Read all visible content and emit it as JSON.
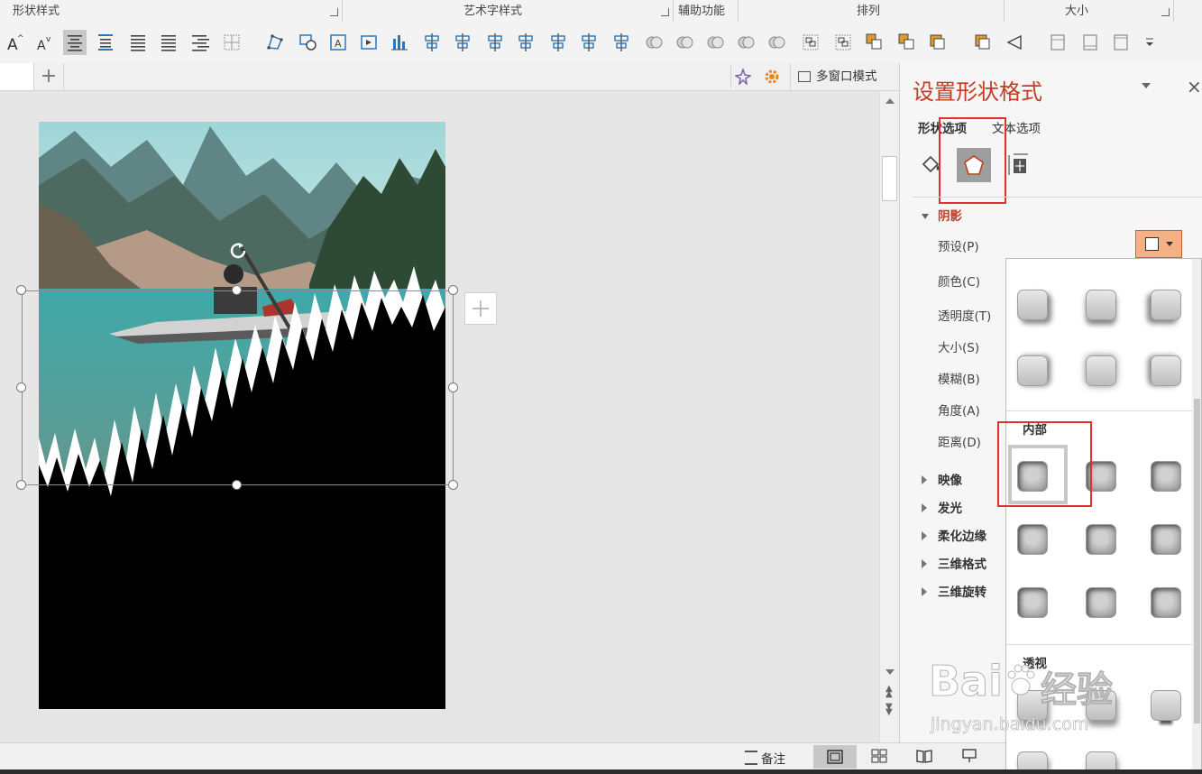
{
  "ribbon": {
    "groups": [
      {
        "label": "形状样式"
      },
      {
        "label": "艺术字样式"
      },
      {
        "label": "辅助功能"
      },
      {
        "label": "排列"
      },
      {
        "label": "大小"
      }
    ],
    "tools": [
      "increase-font-icon",
      "decrease-font-icon",
      "align-center-icon",
      "align-vertical-icon",
      "align-justify-icon",
      "align-left-icon",
      "align-right-icon",
      "table-grid-icon",
      "edit-points-icon",
      "shape-outline-icon",
      "text-box-icon",
      "text-fill-icon",
      "chart-bars-icon",
      "align-top-icon",
      "align-right-edge-icon",
      "align-left-edge-icon",
      "align-center-horizontal-icon",
      "align-middle-icon",
      "distribute-horizontal-icon",
      "distribute-vertical-icon",
      "shape-union-icon",
      "shape-combine-icon",
      "shape-fragment-icon",
      "shape-intersect-icon",
      "shape-subtract-icon",
      "group-icon",
      "ungroup-icon",
      "bring-forward-icon",
      "send-backward-icon",
      "arrange-icon",
      "selection-pane-icon",
      "rotate-icon",
      "height-icon",
      "width-icon",
      "crop-icon",
      "more-icon"
    ]
  },
  "tabstrip": {
    "add_label": "+",
    "multiwindow_label": "多窗口模式"
  },
  "panel": {
    "title": "设置形状格式",
    "tabs": [
      "形状选项",
      "文本选项"
    ],
    "section_shadow": "阴影",
    "preset_label": "预设(P)",
    "props": [
      "颜色(C)",
      "透明度(T)",
      "大小(S)",
      "模糊(B)",
      "角度(A)",
      "距离(D)"
    ],
    "sections": [
      "映像",
      "发光",
      "柔化边缘",
      "三维格式",
      "三维旋转"
    ]
  },
  "gallery": {
    "inner_title": "内部",
    "perspective_title": "透视"
  },
  "statusbar": {
    "notes_label": "备注"
  },
  "watermark": {
    "brand": "Bai",
    "brand_cn": "经验",
    "url": "jingyan.baidu.com"
  },
  "colors": {
    "accent_red": "#c23b22",
    "highlight_box": "#e03030",
    "preset_button": "#f4b183"
  }
}
